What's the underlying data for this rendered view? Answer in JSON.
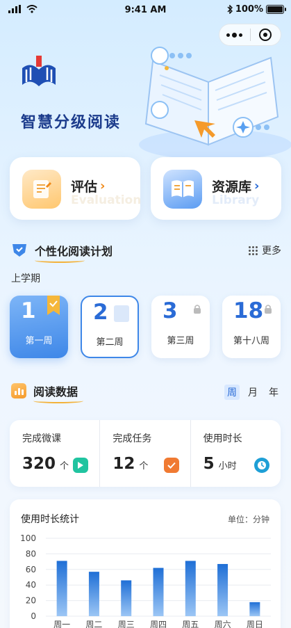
{
  "status_bar": {
    "time": "9:41 AM",
    "battery": "100%",
    "battery_level": 1.0
  },
  "app": {
    "title": "智慧分级阅读"
  },
  "entries": [
    {
      "label": "评估",
      "arrow": "›",
      "subtitle": "Evaluation"
    },
    {
      "label": "资源库",
      "arrow": "›",
      "subtitle": "Library"
    }
  ],
  "plan": {
    "title": "个性化阅读计划",
    "more": "更多",
    "semester": "上学期",
    "weeks": [
      {
        "num": "1",
        "label": "第一周",
        "state": "active"
      },
      {
        "num": "2",
        "label": "第二周",
        "state": "selected"
      },
      {
        "num": "3",
        "label": "第三周",
        "state": "locked"
      },
      {
        "num": "18",
        "label": "第十八周",
        "state": "locked"
      }
    ]
  },
  "reading_data": {
    "title": "阅读数据",
    "periods": [
      "周",
      "月",
      "年"
    ],
    "active_period": "周",
    "stats": [
      {
        "label": "完成微课",
        "value": "320",
        "unit": "个",
        "icon": "play-icon",
        "color": "#20c4a0"
      },
      {
        "label": "完成任务",
        "value": "12",
        "unit": "个",
        "icon": "check-icon",
        "color": "#f07a32"
      },
      {
        "label": "使用时长",
        "value": "5",
        "unit": "小时",
        "icon": "clock-icon",
        "color": "#1e9fd6"
      }
    ]
  },
  "chart_data": {
    "type": "bar",
    "title": "使用时长统计",
    "unit_label": "单位：分钟",
    "categories": [
      "周一",
      "周二",
      "周三",
      "周四",
      "周五",
      "周六",
      "周日"
    ],
    "values": [
      71,
      57,
      46,
      62,
      71,
      67,
      18
    ],
    "ylim": [
      0,
      100
    ],
    "yticks": [
      "100",
      "80",
      "60",
      "40",
      "20",
      "0"
    ],
    "grid": true,
    "bar_color": "#1f6fd6"
  },
  "colors": {
    "accent": "#3e87e8",
    "title_blue": "#1c3c8c",
    "underline": "#f3b23a"
  }
}
